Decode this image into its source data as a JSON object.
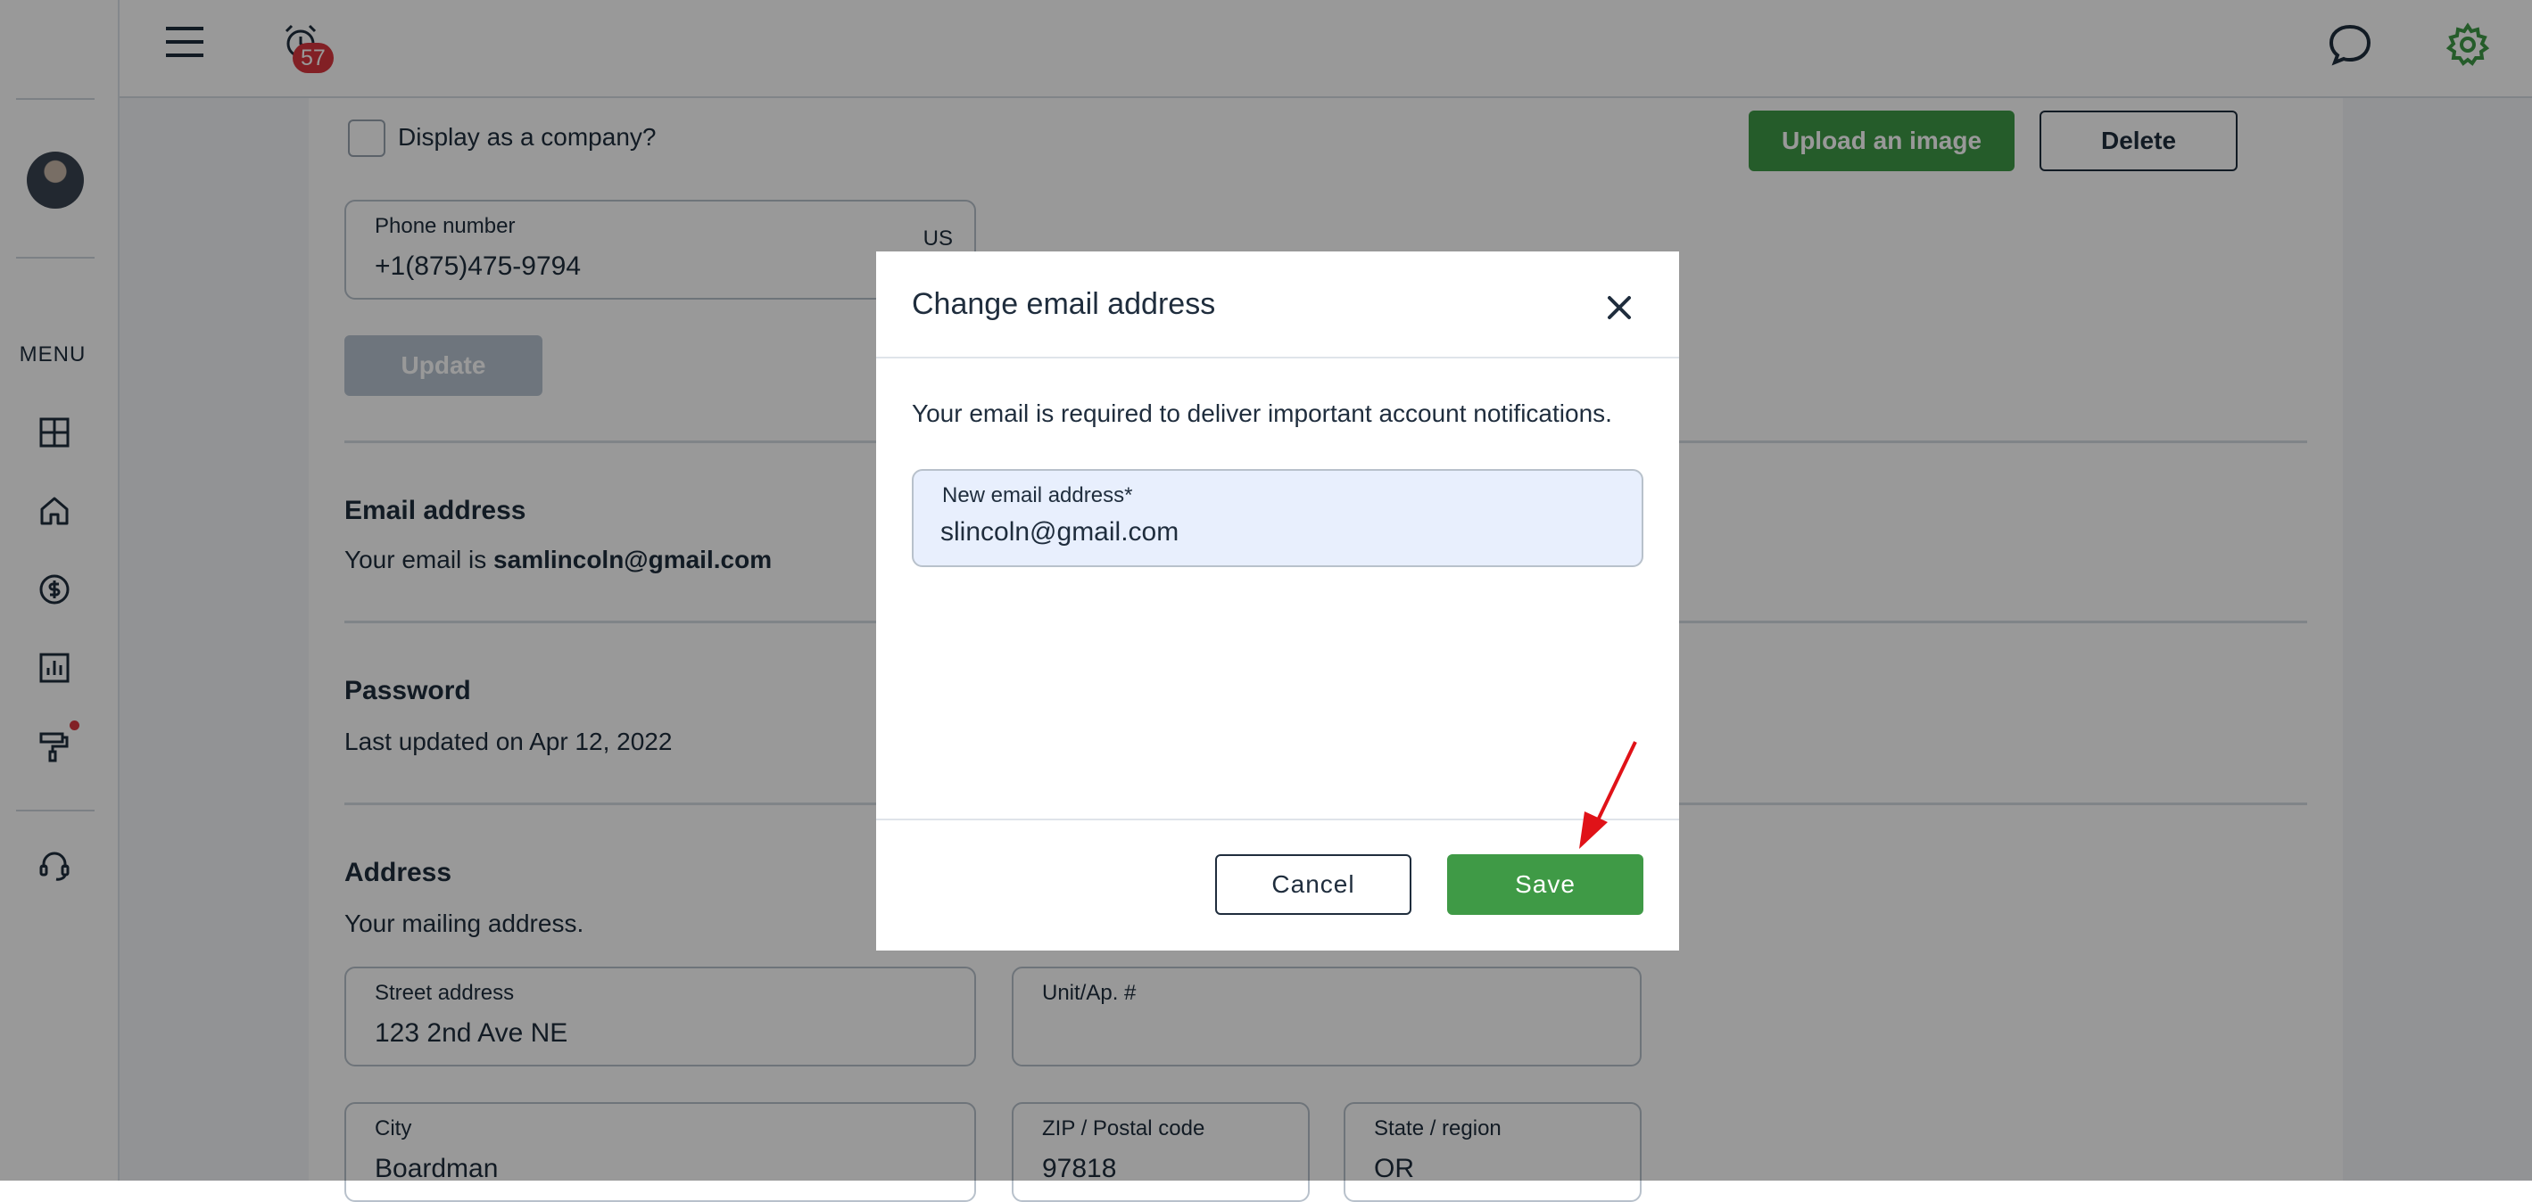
{
  "topbar": {
    "notification_count": "57"
  },
  "sidebar": {
    "menu_label": "MENU"
  },
  "profile": {
    "company_checkbox_label": "Display as a company?",
    "upload_button": "Upload an image",
    "delete_button": "Delete",
    "phone": {
      "label": "Phone number",
      "value": "+1(875)475-9794",
      "country": "US"
    },
    "update_button": "Update"
  },
  "email_section": {
    "title": "Email address",
    "prefix": "Your email is ",
    "current_email": "samlincoln@gmail.com"
  },
  "password_section": {
    "title": "Password",
    "last_updated": "Last updated on Apr 12, 2022"
  },
  "address_section": {
    "title": "Address",
    "description": "Your mailing address.",
    "street": {
      "label": "Street address",
      "value": "123 2nd Ave NE"
    },
    "unit": {
      "label": "Unit/Ap. #",
      "value": ""
    },
    "city": {
      "label": "City",
      "value": "Boardman"
    },
    "zip": {
      "label": "ZIP / Postal code",
      "value": "97818"
    },
    "state": {
      "label": "State / region",
      "value": "OR"
    }
  },
  "modal": {
    "title": "Change email address",
    "description": "Your email is required to deliver important account notifications.",
    "field_label": "New email address*",
    "field_value": "slincoln@gmail.com",
    "cancel_label": "Cancel",
    "save_label": "Save"
  },
  "colors": {
    "accent_green": "#3f9a46",
    "dark_text": "#1f2d3d",
    "badge_red": "#d9363e",
    "annotation_red": "#e01218"
  }
}
